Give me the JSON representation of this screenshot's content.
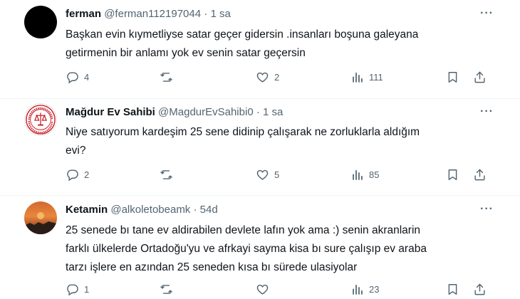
{
  "tweets": [
    {
      "name": "ferman",
      "handle": "@ferman112197044",
      "separator": "·",
      "time": "1 sa",
      "more": "···",
      "lines": [
        "Başkan evin kıymetliyse satar geçer gidersin .insanları boşuna galeyana",
        "getirmenin bir anlamı yok ev senin  satar geçersin"
      ],
      "replies": "4",
      "retweets": "",
      "likes": "2",
      "views": "111"
    },
    {
      "name": "Mağdur Ev Sahibi",
      "handle": "@MagdurEvSahibi0",
      "separator": "·",
      "time": "1 sa",
      "more": "···",
      "lines": [
        "Niye satıyorum kardeşim 25 sene didinip çalışarak ne zorluklarla  aldığım",
        "evi?"
      ],
      "replies": "2",
      "retweets": "",
      "likes": "5",
      "views": "85"
    },
    {
      "name": "Ketamin",
      "handle": "@alkoletobeamk",
      "separator": "·",
      "time": "54d",
      "more": "···",
      "lines": [
        "25 senede bı tane ev aldirabilen devlete lafın yok ama :) senin akranlarin",
        "farklı ülkelerde Ortadoğu'yu ve afrkayi sayma kisa bı sure çalışıp ev araba",
        "tarzı işlere en azından 25 seneden kısa bı sürede ulasiyolar"
      ],
      "replies": "1",
      "retweets": "",
      "likes": "",
      "views": "23"
    }
  ],
  "icons": {
    "reply": "reply-icon",
    "retweet": "retweet-icon",
    "like": "heart-icon",
    "views": "views-icon",
    "bookmark": "bookmark-icon",
    "share": "share-icon"
  },
  "colors": {
    "text": "#0f1419",
    "secondary": "#536471",
    "divider": "#eff3f4"
  }
}
